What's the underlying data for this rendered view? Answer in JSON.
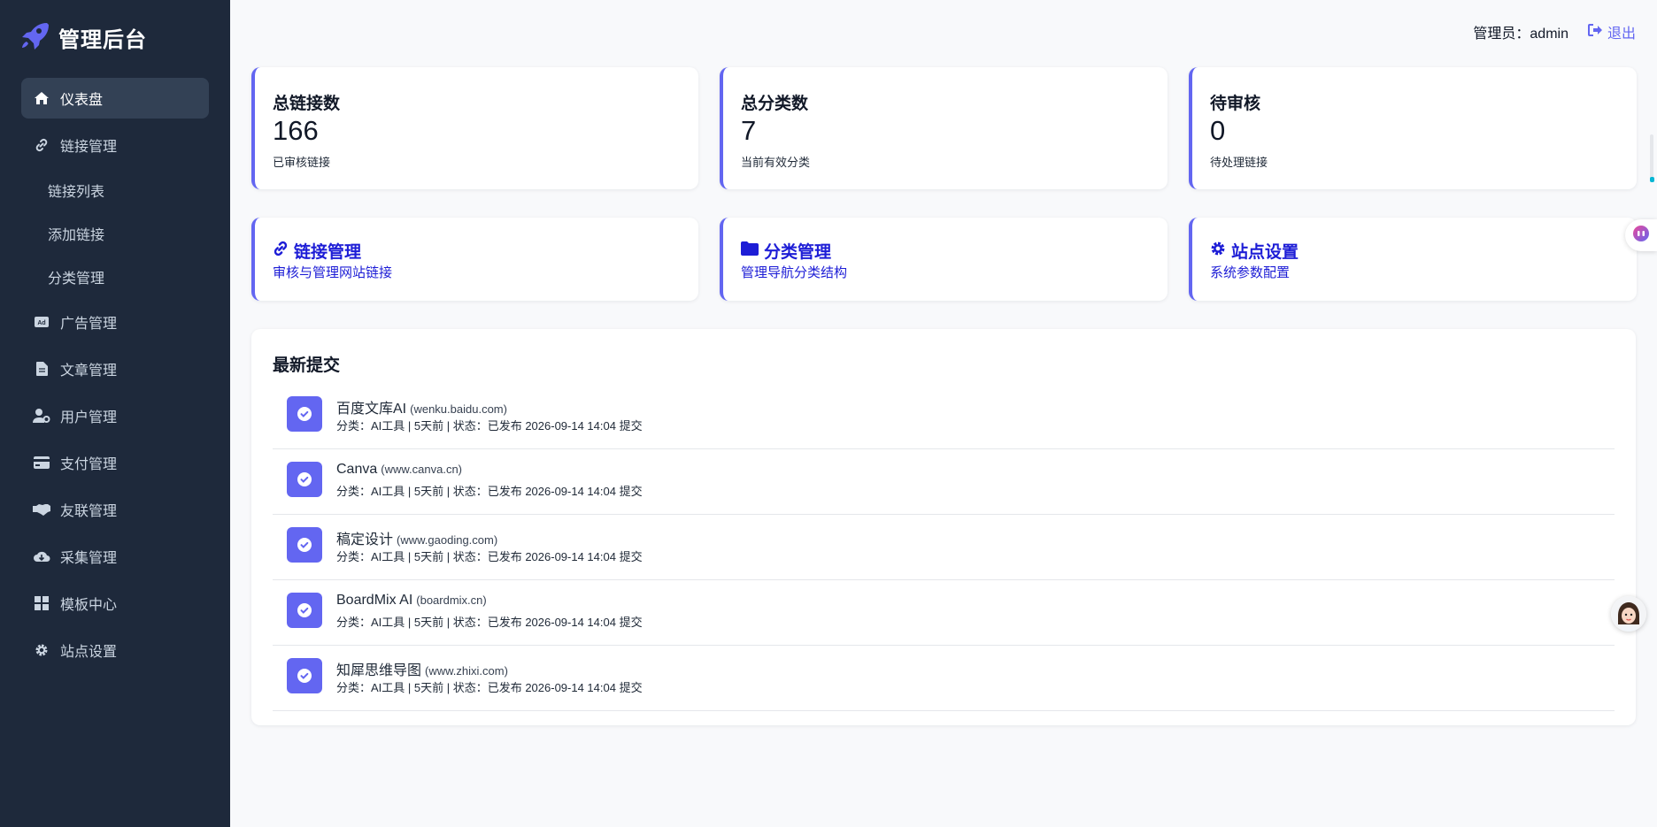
{
  "brand": {
    "title": "管理后台",
    "icon": "rocket-icon"
  },
  "sidebar": {
    "items": [
      {
        "label": "仪表盘",
        "icon": "home-icon",
        "active": true
      },
      {
        "label": "链接管理",
        "icon": "link-icon"
      },
      {
        "label": "链接列表",
        "sub": true
      },
      {
        "label": "添加链接",
        "sub": true
      },
      {
        "label": "分类管理",
        "sub": true
      },
      {
        "label": "广告管理",
        "icon": "ad-icon"
      },
      {
        "label": "文章管理",
        "icon": "file-icon"
      },
      {
        "label": "用户管理",
        "icon": "user-gear-icon"
      },
      {
        "label": "支付管理",
        "icon": "credit-card-icon"
      },
      {
        "label": "友联管理",
        "icon": "handshake-icon"
      },
      {
        "label": "采集管理",
        "icon": "cloud-download-icon"
      },
      {
        "label": "模板中心",
        "icon": "grid-icon"
      },
      {
        "label": "站点设置",
        "icon": "gear-icon"
      }
    ]
  },
  "topbar": {
    "admin_label": "管理员：admin",
    "logout_label": "退出"
  },
  "stats": [
    {
      "title": "总链接数",
      "value": "166",
      "subtitle": "已审核链接"
    },
    {
      "title": "总分类数",
      "value": "7",
      "subtitle": "当前有效分类"
    },
    {
      "title": "待审核",
      "value": "0",
      "subtitle": "待处理链接"
    }
  ],
  "quick_links": [
    {
      "title": "链接管理",
      "subtitle": "审核与管理网站链接",
      "icon": "link-icon"
    },
    {
      "title": "分类管理",
      "subtitle": "管理导航分类结构",
      "icon": "folder-icon"
    },
    {
      "title": "站点设置",
      "subtitle": "系统参数配置",
      "icon": "gear-icon"
    }
  ],
  "recent": {
    "title": "最新提交",
    "items": [
      {
        "name": "百度文库AI",
        "domain": "(wenku.baidu.com)",
        "meta": "分类：AI工具 | 5天前 | 状态：已发布 2026-09-14 14:04 提交"
      },
      {
        "name": "Canva",
        "domain": "(www.canva.cn)",
        "meta": "分类：AI工具 | 5天前 | 状态：已发布 2026-09-14 14:04 提交"
      },
      {
        "name": "稿定设计",
        "domain": "(www.gaoding.com)",
        "meta": "分类：AI工具 | 5天前 | 状态：已发布 2026-09-14 14:04 提交"
      },
      {
        "name": "BoardMix AI",
        "domain": "(boardmix.cn)",
        "meta": "分类：AI工具 | 5天前 | 状态：已发布 2026-09-14 14:04 提交"
      },
      {
        "name": "知犀思维导图",
        "domain": "(www.zhixi.com)",
        "meta": "分类：AI工具 | 5天前 | 状态：已发布 2026-09-14 14:04 提交"
      }
    ]
  },
  "colors": {
    "sidebar_bg": "#1e293b",
    "accent": "#6366f1",
    "link_blue": "#1d1dd6",
    "page_bg": "#f8f9fb"
  }
}
